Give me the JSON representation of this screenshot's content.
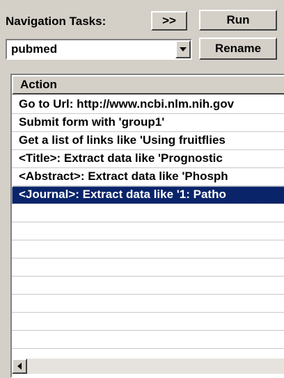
{
  "toolbar": {
    "nav_label": "Navigation Tasks:",
    "expand_label": ">>",
    "run_label": "Run",
    "rename_label": "Rename"
  },
  "task_select": {
    "value": "pubmed"
  },
  "action_list": {
    "header": "Action",
    "selected_index": 5,
    "rows": [
      "Go to Url: http://www.ncbi.nlm.nih.gov",
      "Submit form with 'group1'",
      "Get a list of links like 'Using fruitflies",
      "<Title>: Extract data like 'Prognostic",
      "<Abstract>: Extract data like 'Phosph",
      "<Journal>: Extract data like '1: Patho"
    ],
    "empty_rows": 10
  },
  "icons": {
    "combo_arrow": "chevron-down-icon",
    "scroll_left": "arrow-left-icon"
  },
  "colors": {
    "selection": "#0a246a",
    "face": "#d4d0c8"
  }
}
